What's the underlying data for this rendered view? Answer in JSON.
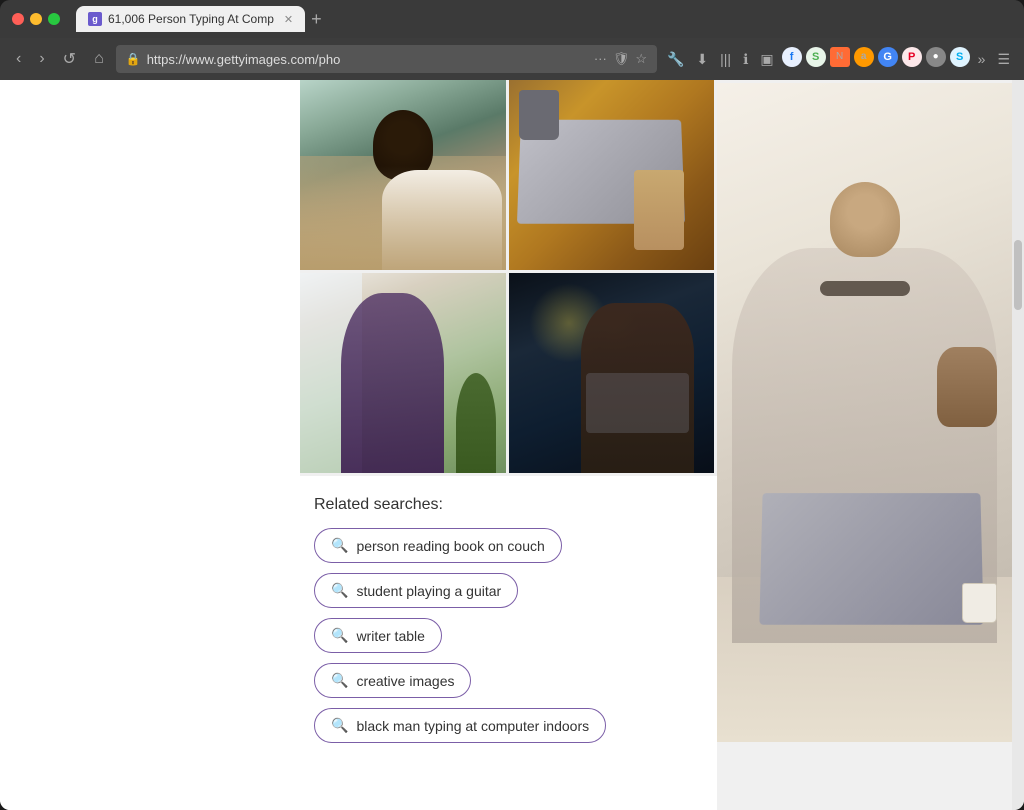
{
  "browser": {
    "tab_title": "61,006 Person Typing At Comp",
    "url": "https://www.gettyimages.com/pho",
    "favicon_letter": "g"
  },
  "related_searches": {
    "title": "Related searches:",
    "items": [
      {
        "id": "rs1",
        "label": "person reading book on couch"
      },
      {
        "id": "rs2",
        "label": "student playing a guitar"
      },
      {
        "id": "rs3",
        "label": "writer table"
      },
      {
        "id": "rs4",
        "label": "creative images"
      },
      {
        "id": "rs5",
        "label": "black man typing at computer indoors"
      }
    ]
  },
  "nav": {
    "back": "‹",
    "forward": "›",
    "reload": "↺",
    "home": "⌂"
  },
  "images": [
    {
      "id": "img1",
      "alt": "Woman with curly hair typing on laptop on couch",
      "class": "photo-woman-couch"
    },
    {
      "id": "img2",
      "alt": "Hands on laptop with phone and coffee",
      "class": "photo-laptop-hands"
    },
    {
      "id": "img3",
      "alt": "Woman relaxing in chair with phone",
      "class": "photo-woman-chair"
    },
    {
      "id": "img4",
      "alt": "Woman typing on laptop at night cafe",
      "class": "photo-woman-night"
    },
    {
      "id": "img5",
      "alt": "Tattooed man typing on laptop with dog",
      "class": "photo-man-dog"
    }
  ]
}
